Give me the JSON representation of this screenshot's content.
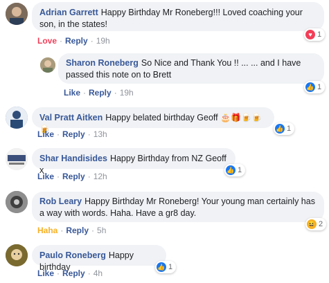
{
  "comments": [
    {
      "name": "Adrian Garrett",
      "text": "Happy Birthday Mr Roneberg!!! Loved coaching your son, in the states!",
      "reaction_action": "Love",
      "reply": "Reply",
      "time": "19h",
      "reaction_count": "1"
    },
    {
      "name": "Sharon Roneberg",
      "text": "So Nice and Thank You !! ... ... and I have passed this note on to Brett",
      "reaction_action": "Like",
      "reply": "Reply",
      "time": "19h",
      "reaction_count": "1"
    },
    {
      "name": "Val Pratt Aitken",
      "text": "Happy belated birthday Geoff",
      "reaction_action": "Like",
      "reply": "Reply",
      "time": "13h",
      "reaction_count": "1"
    },
    {
      "name": "Shar Handisides",
      "text": "Happy Birthday from NZ Geoff x",
      "reaction_action": "Like",
      "reply": "Reply",
      "time": "12h",
      "reaction_count": "1"
    },
    {
      "name": "Rob Leary",
      "text": "Happy Birthday Mr Roneberg! Your young man certainly has a way with words. Haha. Have a gr8 day.",
      "reaction_action": "Haha",
      "reply": "Reply",
      "time": "5h",
      "reaction_count": "2"
    },
    {
      "name": "Paulo Roneberg",
      "text": "Happy birthday",
      "reaction_action": "Like",
      "reply": "Reply",
      "time": "4h",
      "reaction_count": "1"
    }
  ],
  "separator": "·",
  "colors": {
    "link": "#385898",
    "love": "#f33e58",
    "haha": "#f7b125",
    "bubble": "#f0f2f5"
  }
}
